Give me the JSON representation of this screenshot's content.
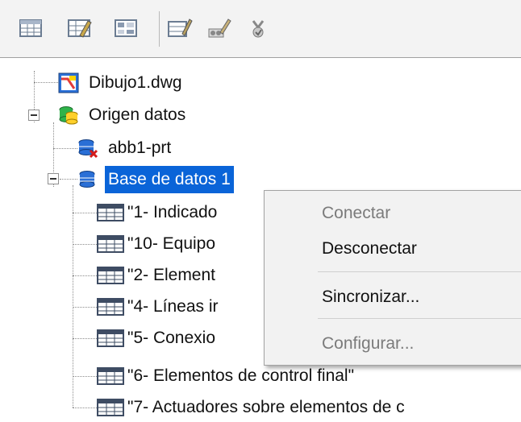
{
  "toolbar": {
    "buttons": [
      {
        "name": "table-view-icon"
      },
      {
        "name": "edit-table-icon"
      },
      {
        "name": "table-grid-icon"
      },
      {
        "name": "link-record-icon"
      },
      {
        "name": "label-template-icon"
      },
      {
        "name": "synchronize-icon"
      }
    ]
  },
  "tree": {
    "drawing": {
      "label": "Dibujo1.dwg",
      "icon": "drawing-file-icon"
    },
    "datasources": {
      "label": "Origen datos",
      "icon": "data-sources-icon"
    },
    "connections": [
      {
        "label": "abb1-prt",
        "icon": "database-disconnected-icon"
      },
      {
        "label": "Base de datos 1",
        "icon": "database-icon",
        "selected": true
      }
    ],
    "tables": [
      {
        "label": "\"1- Indicado"
      },
      {
        "label": "\"10- Equipo"
      },
      {
        "label": "\"2- Element"
      },
      {
        "label": "\"4- Líneas ir"
      },
      {
        "label": "\"5- Conexio"
      },
      {
        "label": "\"6- Elementos de control final\""
      },
      {
        "label": "\"7- Actuadores sobre elementos de c"
      }
    ]
  },
  "context_menu": {
    "items": [
      {
        "label": "Conectar",
        "enabled": false
      },
      {
        "label": "Desconectar",
        "enabled": true
      },
      {
        "label": "Sincronizar...",
        "enabled": true
      },
      {
        "label": "Configurar...",
        "enabled": false
      }
    ]
  },
  "colors": {
    "selection": "#0a64d8",
    "menu_bg": "#f2f2f2",
    "disabled_text": "#7b7b7b"
  }
}
